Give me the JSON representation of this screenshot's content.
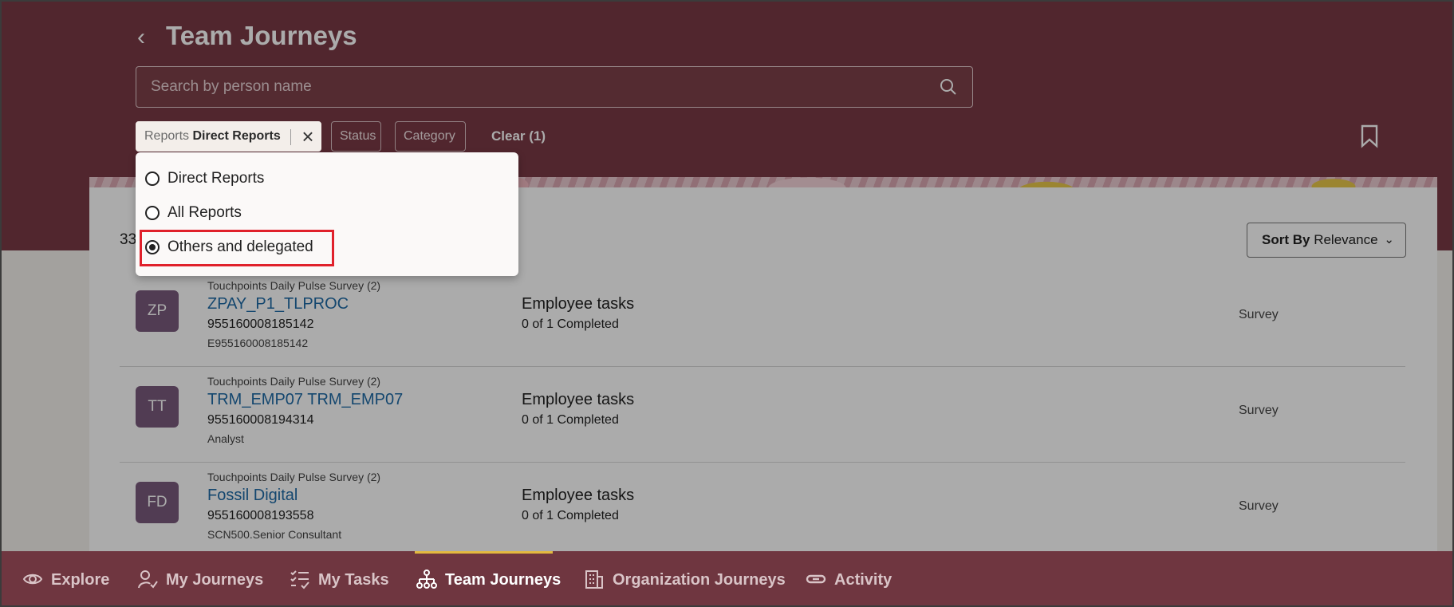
{
  "header": {
    "back_label": "‹",
    "title": "Team Journeys",
    "search": {
      "placeholder": "Search by person name",
      "value": ""
    },
    "filters": {
      "reports_key": "Reports",
      "reports_value": "Direct Reports",
      "status_label": "Status",
      "category_label": "Category",
      "clear_label": "Clear (1)"
    }
  },
  "dropdown": {
    "options": [
      {
        "label": "Direct Reports",
        "selected": false
      },
      {
        "label": "All Reports",
        "selected": false
      },
      {
        "label": "Others and delegated",
        "selected": true
      }
    ]
  },
  "main": {
    "count_text": "33",
    "sort": {
      "prefix": "Sort By",
      "value": "Relevance"
    },
    "rows": [
      {
        "initials": "ZP",
        "category": "Touchpoints Daily Pulse Survey (2)",
        "name": "ZPAY_P1_TLPROC",
        "id": "955160008185142",
        "sub": "E955160008185142",
        "task": "Employee tasks",
        "progress": "0 of 1 Completed",
        "type": "Survey"
      },
      {
        "initials": "TT",
        "category": "Touchpoints Daily Pulse Survey (2)",
        "name": "TRM_EMP07 TRM_EMP07",
        "id": "955160008194314",
        "sub": "Analyst",
        "task": "Employee tasks",
        "progress": "0 of 1 Completed",
        "type": "Survey"
      },
      {
        "initials": "FD",
        "category": "Touchpoints Daily Pulse Survey (2)",
        "name": "Fossil Digital",
        "id": "955160008193558",
        "sub": "SCN500.Senior Consultant",
        "task": "Employee tasks",
        "progress": "0 of 1 Completed",
        "type": "Survey"
      }
    ]
  },
  "bottom_nav": {
    "items": [
      {
        "label": "Explore",
        "icon": "eye-icon"
      },
      {
        "label": "My Journeys",
        "icon": "person-check-icon"
      },
      {
        "label": "My Tasks",
        "icon": "checklist-icon"
      },
      {
        "label": "Team Journeys",
        "icon": "org-chart-icon",
        "active": true
      },
      {
        "label": "Organization Journeys",
        "icon": "building-icon"
      },
      {
        "label": "Activity",
        "icon": "link-icon"
      }
    ]
  },
  "colors": {
    "header_bg": "#7a3a45",
    "accent": "#e3b93f",
    "link": "#1f6aa6",
    "highlight": "#e0212b"
  }
}
